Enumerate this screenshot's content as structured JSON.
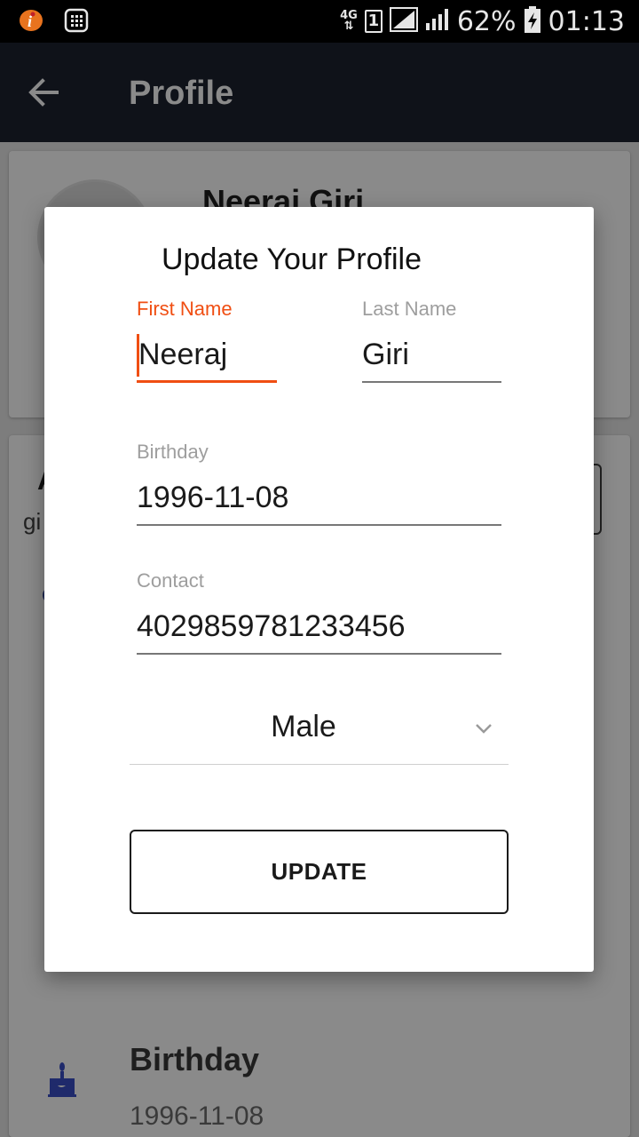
{
  "status_bar": {
    "network": "4G",
    "sim_slot": "1",
    "battery": "62%",
    "time": "01:13"
  },
  "app_bar": {
    "title": "Profile",
    "back_icon": "arrow-left-icon"
  },
  "background": {
    "profile_name": "Neeraj Giri",
    "partial_heading": "A",
    "partial_email": "gi",
    "birthday_label": "Birthday",
    "birthday_value": "1996-11-08"
  },
  "dialog": {
    "title": "Update Your Profile",
    "first_name": {
      "label": "First Name",
      "value": "Neeraj"
    },
    "last_name": {
      "label": "Last Name",
      "value": "Giri"
    },
    "birthday": {
      "label": "Birthday",
      "value": "1996-11-08"
    },
    "contact": {
      "label": "Contact",
      "value": "4029859781233456"
    },
    "gender": {
      "selected": "Male"
    },
    "update_button": "UPDATE"
  },
  "colors": {
    "accent": "#f04e12",
    "app_bar": "#1a1e29",
    "status_bar": "#000000"
  }
}
